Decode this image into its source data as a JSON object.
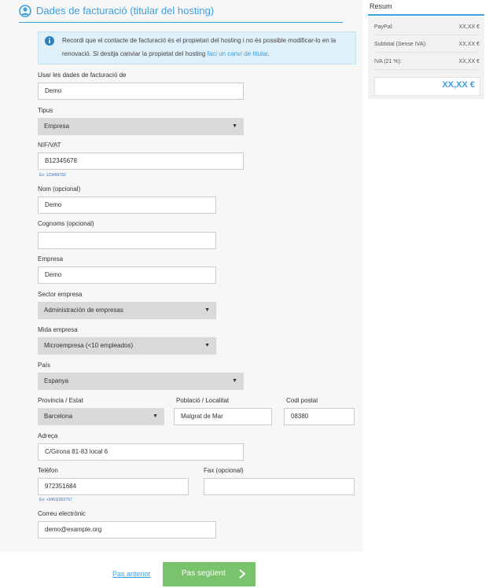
{
  "section": {
    "title": "Dades de facturació (titular del hosting)"
  },
  "info": {
    "text_before": "Recordi que el contacte de facturació és el propietari del hosting i no és possible modificar-lo en la renovació. Si desitja canviar la propietat del hosting ",
    "link": "faci un canvi de titular",
    "text_after": "."
  },
  "form": {
    "usar": {
      "label": "Usar les dades de facturació de",
      "value": "Demo"
    },
    "tipus": {
      "label": "Tipus",
      "value": "Empresa"
    },
    "nif": {
      "label": "NIF/VAT",
      "value": "B12345678",
      "hint": "Ex: 12345678Z"
    },
    "nom": {
      "label": "Nom (opcional)",
      "value": "Demo"
    },
    "cognoms": {
      "label": "Cognoms (opcional)",
      "value": ""
    },
    "empresa": {
      "label": "Empresa",
      "value": "Demo"
    },
    "sector": {
      "label": "Sector empresa",
      "value": "Administración de empresas"
    },
    "mida": {
      "label": "Mida empresa",
      "value": "Microempresa (<10 empleados)"
    },
    "pais": {
      "label": "País",
      "value": "Espanya"
    },
    "provincia": {
      "label": "Provincia / Estat",
      "value": "Barcelona"
    },
    "poblacio": {
      "label": "Població / Localitat",
      "value": "Malgrat de Mar"
    },
    "codi_postal": {
      "label": "Codi postal",
      "value": "08380"
    },
    "adreca": {
      "label": "Adreça",
      "value": "C/Girona 81-83 local 6"
    },
    "telefon": {
      "label": "Telèfon",
      "value": "972351684",
      "hint": "Ex: +34911822767"
    },
    "fax": {
      "label": "Fax (opcional)",
      "value": ""
    },
    "email": {
      "label": "Correu electrònic",
      "value": "demo@example.org"
    }
  },
  "resum": {
    "title": "Resum",
    "rows": [
      {
        "label": "PayPal:",
        "value": "XX,XX €"
      },
      {
        "label": "Subtotal (Sense IVA):",
        "value": "XX,XX €"
      },
      {
        "label": "IVA (21 %):",
        "value": "XX,XX €"
      }
    ],
    "total": "XX,XX €"
  },
  "nav": {
    "prev": "Pas anterior",
    "next": "Pas següent"
  },
  "icons": {
    "section": "user-circle-icon",
    "info": "info-icon",
    "select": "caret-down-icon",
    "next": "chevron-right-icon"
  },
  "colors": {
    "accent": "#3d9ee0",
    "button": "#7ac26b",
    "info_bg": "#dff0f9",
    "select_bg": "#d9d9d9",
    "panel_bg": "#f7f7f7"
  }
}
